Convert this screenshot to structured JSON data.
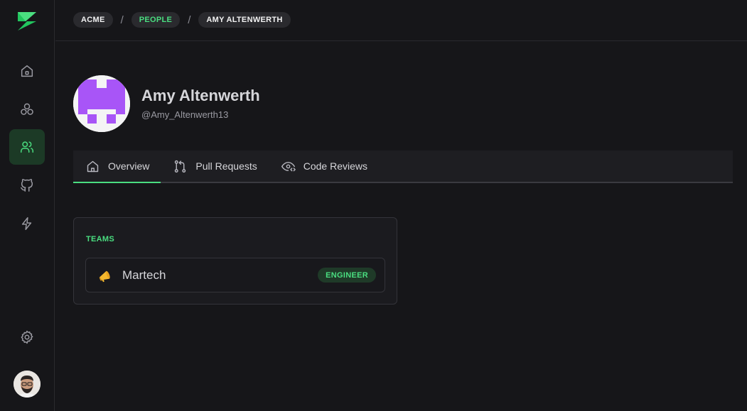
{
  "sidebar": {
    "logo_icon": "lightning-z-logo",
    "items": [
      {
        "name": "home",
        "icon": "home-icon",
        "active": false
      },
      {
        "name": "groups",
        "icon": "circles-icon",
        "active": false
      },
      {
        "name": "people",
        "icon": "users-icon",
        "active": true
      },
      {
        "name": "github",
        "icon": "github-icon",
        "active": false
      },
      {
        "name": "integrations",
        "icon": "lightning-icon",
        "active": false
      }
    ],
    "settings_icon": "gear-icon",
    "user_avatar": "user-avatar"
  },
  "breadcrumb": [
    {
      "label": "ACME"
    },
    {
      "label": "PEOPLE"
    },
    {
      "label": "AMY ALTENWERTH"
    }
  ],
  "profile": {
    "name": "Amy Altenwerth",
    "handle": "@Amy_Altenwerth13"
  },
  "tabs": [
    {
      "label": "Overview",
      "icon": "home-icon",
      "active": true
    },
    {
      "label": "Pull Requests",
      "icon": "git-pull-request-icon",
      "active": false
    },
    {
      "label": "Code Reviews",
      "icon": "eye-code-icon",
      "active": false
    }
  ],
  "teams_card": {
    "title": "TEAMS",
    "teams": [
      {
        "name": "Martech",
        "role": "ENGINEER",
        "icon": "megaphone-icon"
      }
    ]
  },
  "colors": {
    "accent": "#4ade80",
    "background": "#161619",
    "avatar_purple": "#a855f7"
  }
}
